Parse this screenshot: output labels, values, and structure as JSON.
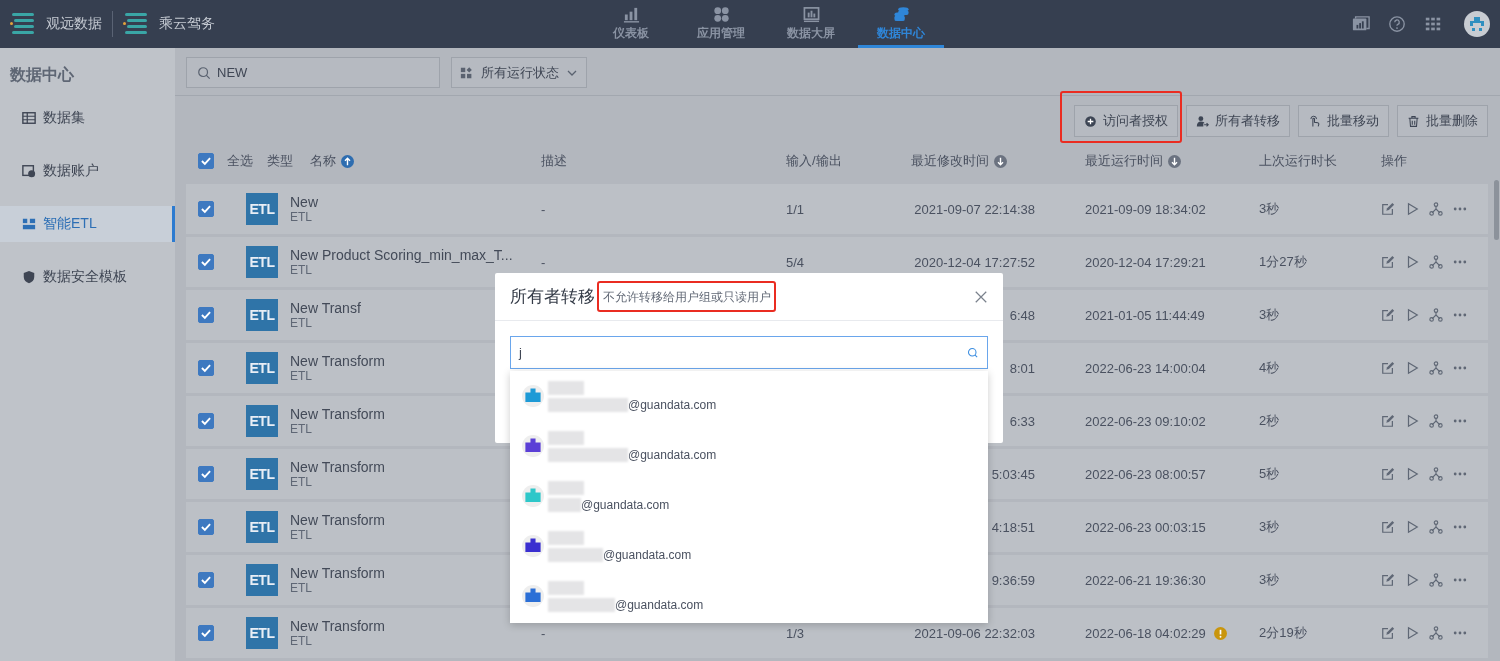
{
  "header": {
    "brands": [
      {
        "name": "观远数据"
      },
      {
        "name": "乘云驾务"
      }
    ],
    "nav": [
      {
        "label": "仪表板",
        "selected": false
      },
      {
        "label": "应用管理",
        "selected": false
      },
      {
        "label": "数据大屏",
        "selected": false
      },
      {
        "label": "数据中心",
        "selected": true
      }
    ]
  },
  "sidebar": {
    "title": "数据中心",
    "items": [
      {
        "label": "数据集",
        "selected": false
      },
      {
        "label": "数据账户",
        "selected": false
      },
      {
        "label": "智能ETL",
        "selected": true
      },
      {
        "label": "数据安全模板",
        "selected": false
      }
    ]
  },
  "toolbar": {
    "search": {
      "value": "NEW"
    },
    "status_filter": "所有运行状态"
  },
  "actions": [
    {
      "label": "访问者授权",
      "annotated": true
    },
    {
      "label": "所有者转移",
      "annotated": false
    },
    {
      "label": "批量移动",
      "annotated": false
    },
    {
      "label": "批量删除",
      "annotated": false
    }
  ],
  "table": {
    "select_all": {
      "label": "全选",
      "checked": true
    },
    "columns": [
      {
        "label": "类型",
        "sortable": false
      },
      {
        "label": "名称",
        "sortable": true,
        "ascending": true
      },
      {
        "label": "描述",
        "sortable": false
      },
      {
        "label": "输入/输出",
        "sortable": false
      },
      {
        "label": "最近修改时间",
        "sortable": true,
        "ascending": false
      },
      {
        "label": "最近运行时间",
        "sortable": true,
        "ascending": false
      },
      {
        "label": "上次运行时长",
        "sortable": false
      },
      {
        "label": "操作",
        "sortable": false
      }
    ],
    "rows": [
      {
        "checked": true,
        "badge": "ETL",
        "name": "New",
        "type": "ETL",
        "description": "-",
        "io": "1/1",
        "modified": "2021-09-07 22:14:38",
        "last_run": "2021-09-09 18:34:02",
        "warning": false,
        "duration": "3秒"
      },
      {
        "checked": true,
        "badge": "ETL",
        "name": "New Product Scoring_min_max_T...",
        "type": "ETL",
        "description": "-",
        "io": "5/4",
        "modified": "2020-12-04 17:27:52",
        "last_run": "2020-12-04 17:29:21",
        "warning": false,
        "duration": "1分27秒"
      },
      {
        "checked": true,
        "badge": "ETL",
        "name": "New Transf",
        "type": "ETL",
        "modified": "6:48",
        "last_run": "2021-01-05 11:44:49",
        "warning": false,
        "duration": "3秒"
      },
      {
        "checked": true,
        "badge": "ETL",
        "name": "New Transform",
        "type": "ETL",
        "modified": "8:01",
        "last_run": "2022-06-23 14:00:04",
        "warning": false,
        "duration": "4秒"
      },
      {
        "checked": true,
        "badge": "ETL",
        "name": "New Transform",
        "type": "ETL",
        "modified": "6:33",
        "last_run": "2022-06-23 09:10:02",
        "warning": false,
        "duration": "2秒"
      },
      {
        "checked": true,
        "badge": "ETL",
        "name": "New Transform",
        "type": "ETL",
        "modified": "5:03:45",
        "last_run": "2022-06-23 08:00:57",
        "warning": false,
        "duration": "5秒"
      },
      {
        "checked": true,
        "badge": "ETL",
        "name": "New Transform",
        "type": "ETL",
        "modified": "4:18:51",
        "last_run": "2022-06-23 00:03:15",
        "warning": false,
        "duration": "3秒"
      },
      {
        "checked": true,
        "badge": "ETL",
        "name": "New Transform",
        "type": "ETL",
        "modified": "9:36:59",
        "last_run": "2022-06-21 19:36:30",
        "warning": false,
        "duration": "3秒"
      },
      {
        "checked": true,
        "badge": "ETL",
        "name": "New Transform",
        "type": "ETL",
        "description": "-",
        "io": "1/3",
        "modified": "2021-09-06 22:32:03",
        "last_run": "2022-06-18 04:02:29",
        "warning": true,
        "duration": "2分19秒"
      }
    ]
  },
  "modal": {
    "title": "所有者转移",
    "hint": "不允许转移给用户组或只读用户",
    "hint_annotated": true,
    "search": {
      "value": "j"
    },
    "users": [
      {
        "color": "#1e9ad6",
        "email_suffix": "@guandata.com"
      },
      {
        "color": "#5b3fd6",
        "email_suffix": "@guandata.com"
      },
      {
        "color": "#2ec7c9",
        "email_suffix": "@guandata.com"
      },
      {
        "color": "#3a2fd0",
        "email_suffix": "@guandata.com"
      },
      {
        "color": "#2b6fd6",
        "email_suffix": "@guandata.com"
      }
    ]
  }
}
